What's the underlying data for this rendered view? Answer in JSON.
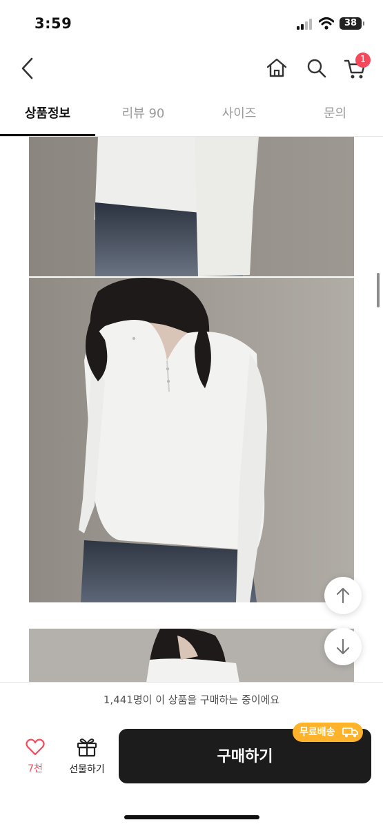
{
  "status_bar": {
    "time": "3:59",
    "battery": "38"
  },
  "header": {
    "cart_count": "1"
  },
  "tabs": [
    {
      "label": "상품정보",
      "active": true
    },
    {
      "label": "리뷰 90",
      "active": false
    },
    {
      "label": "사이즈",
      "active": false
    },
    {
      "label": "문의",
      "active": false
    }
  ],
  "notice": "1,441명이 이 상품을 구매하는 중이에요",
  "bottom": {
    "like_count": "7천",
    "gift_label": "선물하기",
    "buy_label": "구매하기",
    "free_shipping_badge": "무료배송"
  },
  "colors": {
    "accent": "#f4495b",
    "badge": "#ffb32a",
    "buy_button": "#1c1c1c"
  },
  "icons": [
    "back-arrow-icon",
    "home-icon",
    "search-icon",
    "cart-icon",
    "arrow-up-icon",
    "arrow-down-icon",
    "heart-icon",
    "gift-icon",
    "truck-icon"
  ]
}
